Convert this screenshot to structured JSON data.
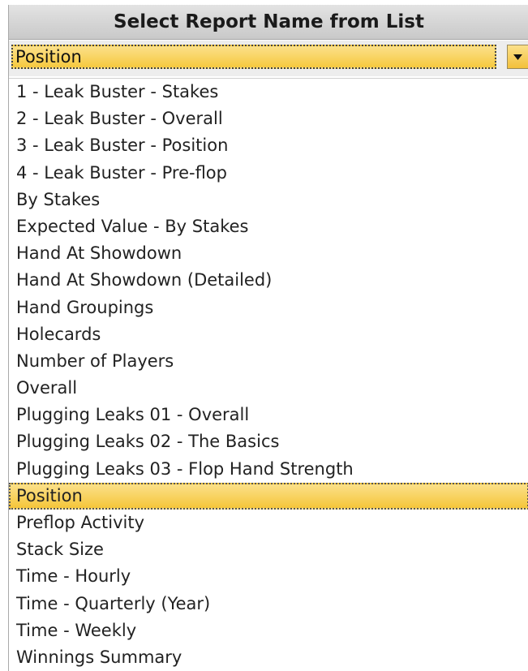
{
  "header": {
    "title": "Select Report Name from List"
  },
  "combo": {
    "value": "Position",
    "arrow_icon": "chevron-down-icon"
  },
  "list": {
    "selected_index": 15,
    "items": [
      "1 - Leak Buster - Stakes",
      "2 - Leak Buster - Overall",
      "3 - Leak Buster - Position",
      "4 - Leak Buster - Pre-flop",
      "By Stakes",
      "Expected Value - By Stakes",
      "Hand At Showdown",
      "Hand At Showdown (Detailed)",
      "Hand Groupings",
      "Holecards",
      "Number of Players",
      "Overall",
      "Plugging Leaks 01 - Overall",
      "Plugging Leaks 02 - The Basics",
      "Plugging Leaks 03 - Flop Hand Strength",
      "Position",
      "Preflop Activity",
      "Stack Size",
      "Time - Hourly",
      "Time - Quarterly (Year)",
      "Time - Weekly",
      "Winnings Summary"
    ]
  },
  "colors": {
    "selection": "#f6c93f",
    "header_bg": "#d4d4d4"
  }
}
